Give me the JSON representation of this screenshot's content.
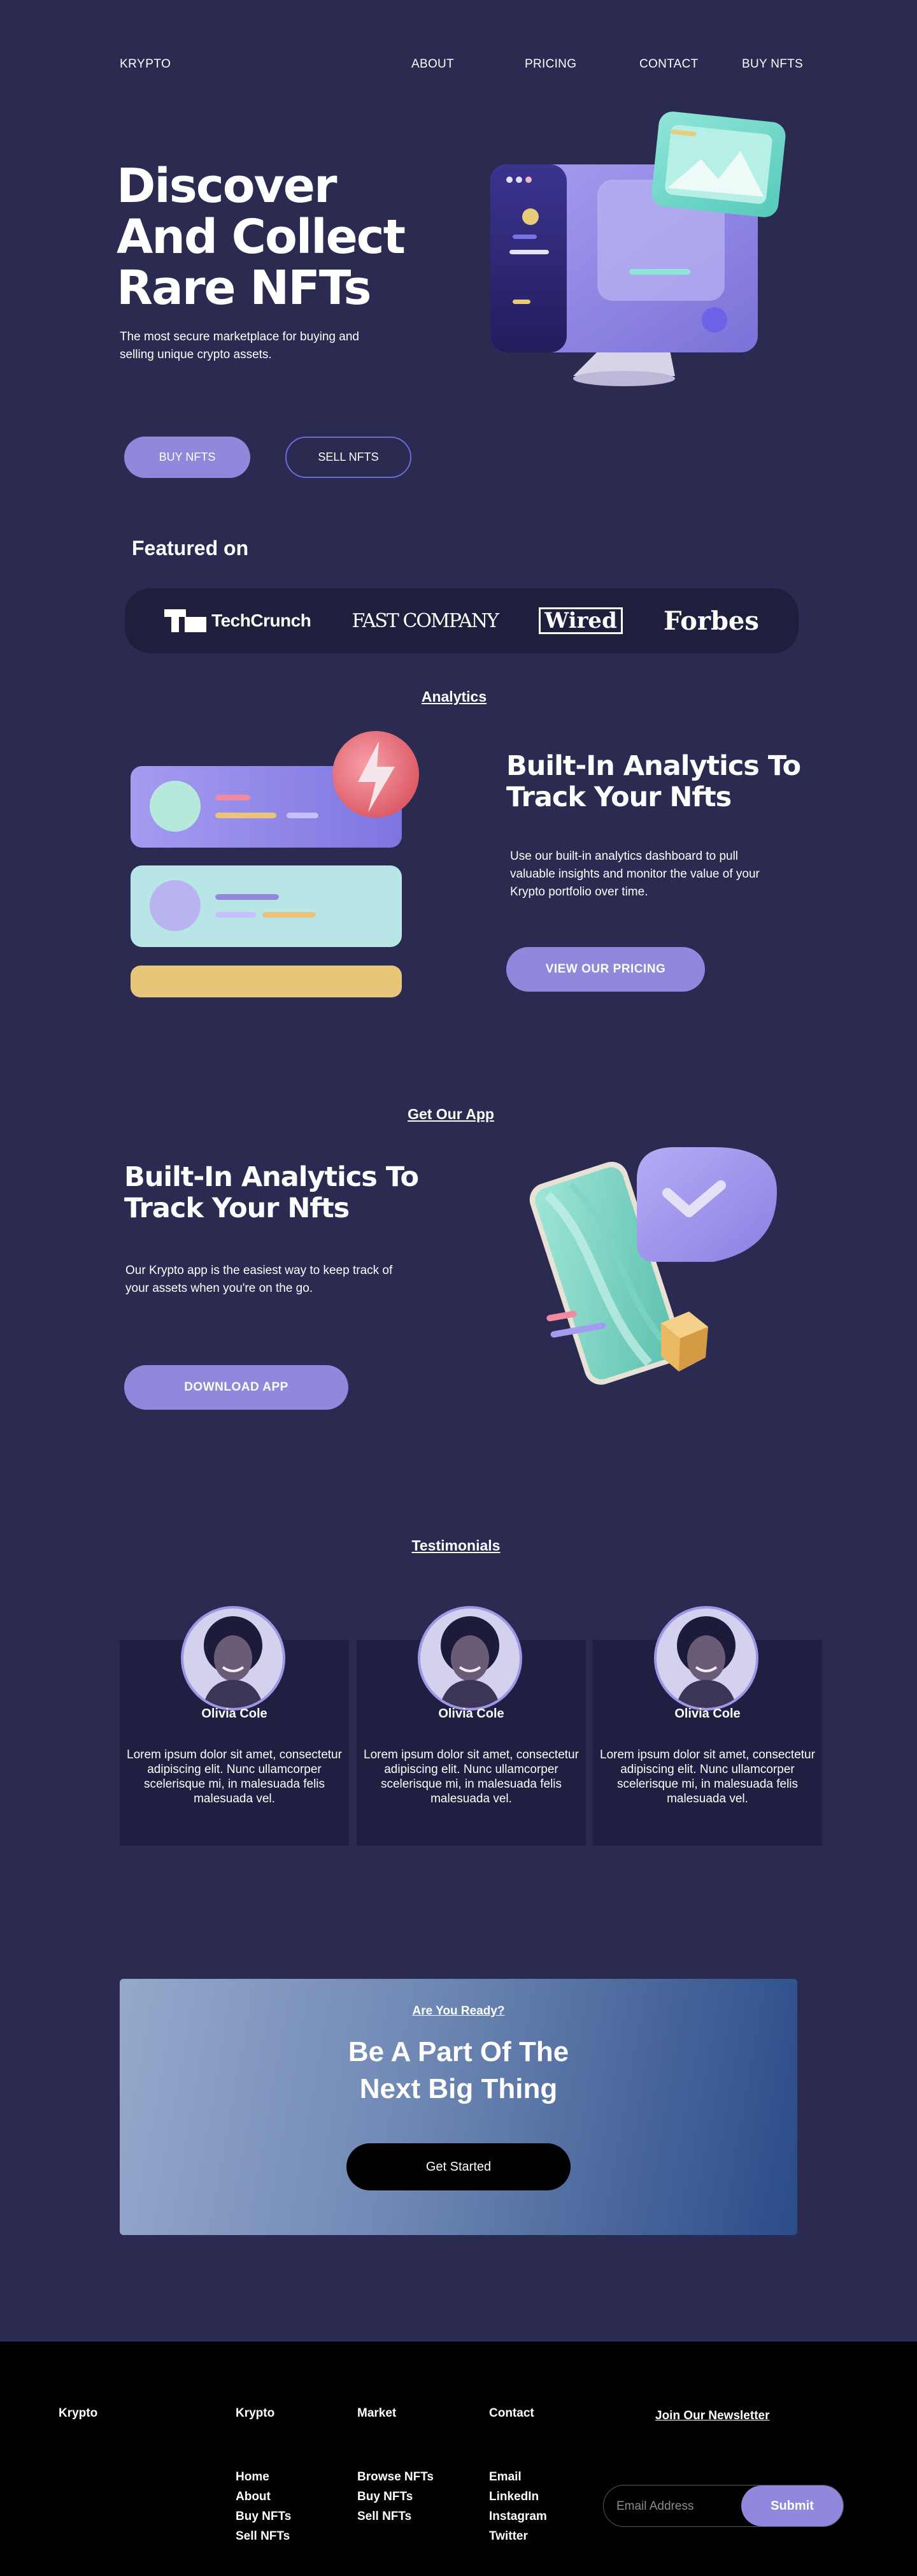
{
  "nav": {
    "brand": "KRYPTO",
    "links": [
      "ABOUT",
      "PRICING",
      "CONTACT",
      "BUY NFTS"
    ]
  },
  "hero": {
    "title_lines": [
      "Discover",
      "And Collect",
      "Rare NFTs"
    ],
    "subtitle": "The most secure marketplace for buying and selling unique crypto assets.",
    "buy_label": "BUY NFTS",
    "sell_label": "SELL NFTS"
  },
  "featured": {
    "title": "Featured on",
    "logos": [
      "TechCrunch",
      "FAST COMPANY",
      "Wired",
      "Forbes"
    ]
  },
  "analytics": {
    "section_label": "Analytics",
    "title": "Built-In Analytics To Track Your Nfts",
    "body": "Use our built-in analytics dashboard to pull valuable insights and monitor the value of your Krypto portfolio over time.",
    "button": "VIEW  OUR PRICING"
  },
  "app": {
    "section_label": "Get Our App",
    "title": "Built-In Analytics To Track Your Nfts",
    "body": "Our Krypto app is the easiest way to keep track of your assets when you're on the go.",
    "button": "DOWNLOAD APP"
  },
  "testimonials": {
    "section_label": "Testimonials",
    "items": [
      {
        "name": "Olivia Cole",
        "text": "Lorem ipsum dolor sit amet, consectetur adipiscing elit. Nunc ullamcorper scelerisque mi, in malesuada felis malesuada vel."
      },
      {
        "name": "Olivia Cole",
        "text": "Lorem ipsum dolor sit amet, consectetur adipiscing elit. Nunc ullamcorper scelerisque mi, in malesuada felis malesuada vel."
      },
      {
        "name": "Olivia Cole",
        "text": "Lorem ipsum dolor sit amet, consectetur adipiscing elit. Nunc ullamcorper scelerisque mi, in malesuada felis malesuada vel."
      }
    ]
  },
  "cta": {
    "eyebrow": "Are You Ready?",
    "title_line1": "Be A Part Of The",
    "title_line2": "Next Big Thing",
    "button": "Get Started"
  },
  "footer": {
    "brand": "Krypto",
    "columns": [
      {
        "heading": "Krypto",
        "links": [
          "Home",
          "About",
          "Buy NFTs",
          "Sell NFTs"
        ]
      },
      {
        "heading": "Market",
        "links": [
          "Browse NFTs",
          "Buy NFTs",
          "Sell NFTs"
        ]
      },
      {
        "heading": "Contact",
        "links": [
          "Email",
          "LinkedIn",
          "Instagram",
          "Twitter"
        ]
      }
    ],
    "newsletter": {
      "heading": "Join Our Newsletter",
      "placeholder": "Email Address",
      "button": "Submit"
    }
  },
  "colors": {
    "background": "#2b2b52",
    "accent": "#8f88dc",
    "card": "#1f1f42",
    "footer": "#000000"
  }
}
